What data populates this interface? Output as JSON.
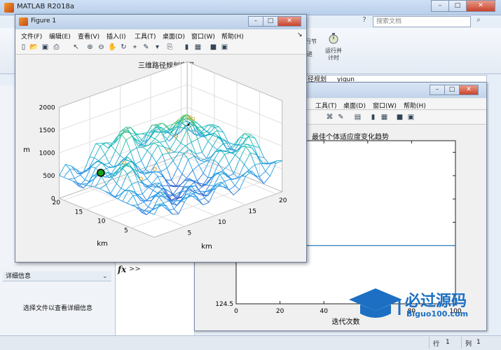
{
  "main_window": {
    "title": "MATLAB R2018a",
    "search_placeholder": "搜索文档",
    "toolstrip": {
      "run_section": "行节",
      "advance": "进",
      "run_and_time": "运行并计时"
    },
    "address_path": "径规划",
    "address_folder": "yiqun",
    "details_header": "详细信息",
    "details_message": "选择文件以查看详细信息",
    "fx_prompt": ">>",
    "status_row_label": "行",
    "status_row_value": "1",
    "status_col_label": "列",
    "status_col_value": "1"
  },
  "figure1": {
    "title": "Figure 1",
    "menus": [
      "文件(F)",
      "编辑(E)",
      "查看(V)",
      "插入(I)",
      "工具(T)",
      "桌面(D)",
      "窗口(W)",
      "帮助(H)"
    ]
  },
  "figure2": {
    "menus": [
      "工具(T)",
      "桌面(D)",
      "窗口(W)",
      "帮助(H)"
    ]
  },
  "chart_data": [
    {
      "type": "surface",
      "title": "三维路径规划空间",
      "xlabel": "km",
      "ylabel": "km",
      "zlabel": "m",
      "x_ticks": [
        "5",
        "10",
        "15",
        "20"
      ],
      "y_ticks": [
        "5",
        "10",
        "15",
        "20"
      ],
      "z_ticks": [
        "0",
        "500",
        "1000",
        "1500",
        "2000"
      ],
      "zlim": [
        0,
        2000
      ],
      "grid": true,
      "colormap": "parula",
      "markers": [
        {
          "name": "start",
          "color": "#22aa22"
        }
      ]
    },
    {
      "type": "line",
      "title": "最佳个体适应度变化趋势",
      "xlabel": "迭代次数",
      "x_ticks": [
        "0",
        "20",
        "40",
        "60",
        "80",
        "100"
      ],
      "y_ticks": [
        "124.5",
        "125"
      ],
      "series": [
        {
          "color": "#2f7fc1",
          "x": [
            0,
            26,
            26,
            100
          ],
          "y": [
            125.6,
            125.6,
            125.0,
            125.0
          ]
        }
      ]
    }
  ],
  "watermark": {
    "text": "必过源码",
    "sub": "Biguo100.com"
  }
}
